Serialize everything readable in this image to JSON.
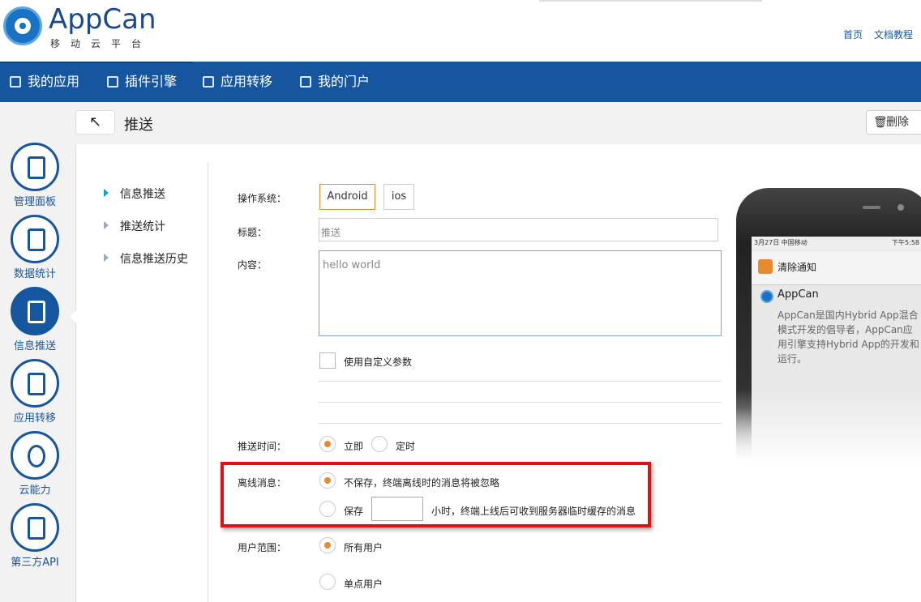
{
  "header": {
    "logo_text": "AppCan",
    "logo_sub": "移动云平台",
    "links": [
      "首页",
      "文档教程"
    ]
  },
  "nav": {
    "items": [
      "我的应用",
      "插件引擎",
      "应用转移",
      "我的门户"
    ]
  },
  "left_rail": {
    "items": [
      "管理面板",
      "数据统计",
      "信息推送",
      "应用转移",
      "云能力",
      "第三方API"
    ],
    "active": "信息推送"
  },
  "titlebar": {
    "back_icon": "↖",
    "title": "推送",
    "delete_label": "删除"
  },
  "sub_nav": {
    "items": [
      "信息推送",
      "推送统计",
      "信息推送历史"
    ],
    "active": "信息推送"
  },
  "form": {
    "os_label": "操作系统：",
    "os_options": [
      "Android",
      "ios"
    ],
    "os_selected": "Android",
    "title_label": "标题：",
    "title_placeholder": "推送",
    "content_label": "内容：",
    "content_value": "hello world",
    "custom_param_label": "使用自定义参数",
    "push_time_label": "推送时间：",
    "push_time_options": [
      "立即",
      "定时"
    ],
    "push_time_selected": "立即",
    "offline_label": "离线消息：",
    "offline_opt1": "不保存，终端离线时的消息将被忽略",
    "offline_opt2_prefix": "保存",
    "offline_opt2_suffix": "小时，终端上线后可收到服务器临时缓存的消息",
    "offline_selected": "不保存",
    "user_scope_label": "用户范围：",
    "user_scope_options": [
      "所有用户",
      "单点用户"
    ],
    "user_scope_selected": "所有用户"
  },
  "phone_preview": {
    "status_left": "3月27日  中国移动",
    "status_right": "下午5:58",
    "clear_label": "清除通知",
    "app_name": "AppCan",
    "message": "AppCan是国内Hybrid App混合模式开发的倡导者，AppCan应用引擎支持Hybrid App的开发和运行。"
  },
  "colors": {
    "brand_blue": "#16569e",
    "accent_orange": "#e8892b",
    "highlight_red": "#e20f14"
  }
}
